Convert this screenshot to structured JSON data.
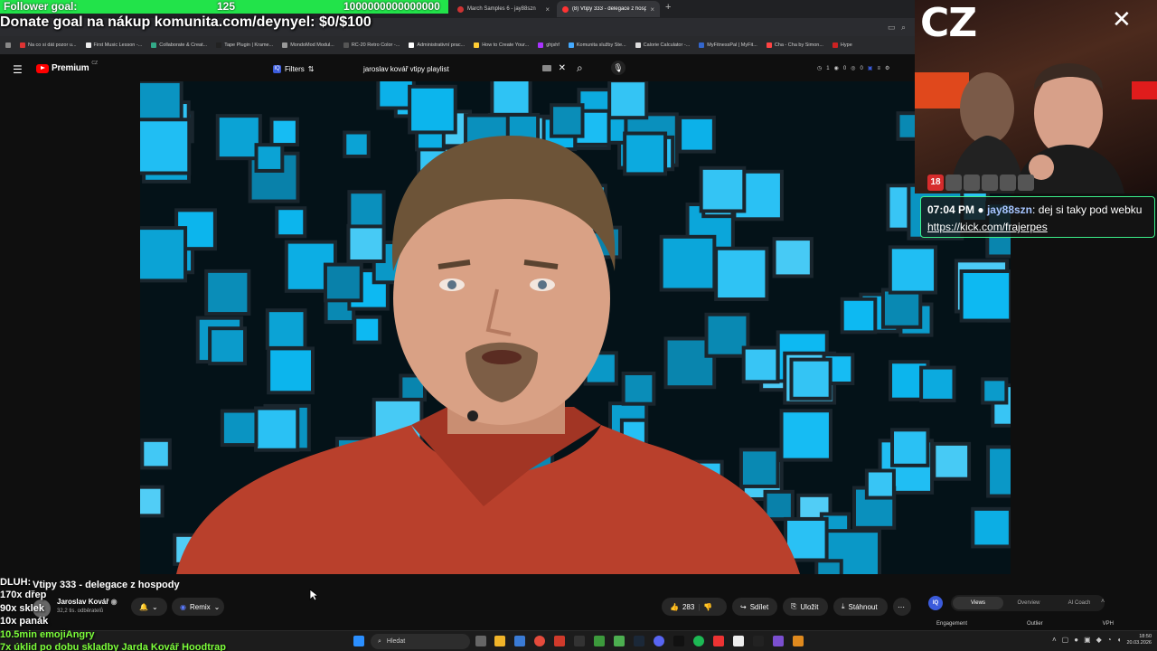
{
  "stream_overlay": {
    "follower_goal_label": "Follower goal:",
    "follower_goal_current": "125",
    "follower_goal_target": "1000000000000000",
    "donate_goal": "Donate goal na nákup komunita.com/deynyel: $0/$100"
  },
  "browser": {
    "tabs": [
      {
        "label": "March Samples 6 - jay88szn",
        "active": false
      },
      {
        "label": "(8) Vtipy 333 - delegace z hosp",
        "active": true
      }
    ],
    "bookmarks": [
      "Na co si dát pozor u...",
      "First Music Lesson -...",
      "Collaborate & Creat...",
      "Tape Plugin | Krame...",
      "MondoMod Modul...",
      "RC-20 Retro Color -...",
      "Administrativní prac...",
      "How to Create Your...",
      "ghjshf",
      "Komunita služby Ste...",
      "Calorie Calculator -...",
      "MyFitnessPal | MyFit...",
      "Cha - Cha by Simon...",
      "Hype"
    ]
  },
  "youtube": {
    "logo_text": "Premium",
    "logo_region": "CZ",
    "filters_label": "Filters",
    "search_query": "jaroslav kovář vtipy playlist",
    "header_stats": [
      "1",
      "0",
      "0"
    ],
    "video_title": "Vtipy 333 - delegace z hospody",
    "channel_name": "Jaroslav Kovář",
    "subscribers": "32,2 tis. odběratelů",
    "remix_label": "Remix",
    "like_count": "283",
    "share_label": "Sdílet",
    "save_label": "Uložit",
    "download_label": "Stáhnout"
  },
  "vidiq": {
    "tabs": [
      "Views",
      "Overview",
      "AI Coach"
    ],
    "active_tab": "Views",
    "columns": [
      "Engagement",
      "Outlier",
      "VPH"
    ]
  },
  "webcam": {
    "title": "CZ"
  },
  "chat": {
    "time": "07:04 PM",
    "user": "jay88szn",
    "message": "dej si taky pod webku",
    "link": "https://kick.com/frajerpes"
  },
  "left_overlay": {
    "lines": [
      {
        "text": "DLUH:",
        "green": false
      },
      {
        "text": "170x dřep",
        "green": false
      },
      {
        "text": "90x sklek",
        "green": false
      },
      {
        "text": "10x panák",
        "green": false
      },
      {
        "text": "10.5min emojiAngry",
        "green": true
      },
      {
        "text": "7x úklid po dobu skladby Jarda Kovář Hoodtrap",
        "green": true
      }
    ]
  },
  "taskbar": {
    "search_placeholder": "Hledat",
    "time": "18:50",
    "date": "20.03.2026"
  }
}
